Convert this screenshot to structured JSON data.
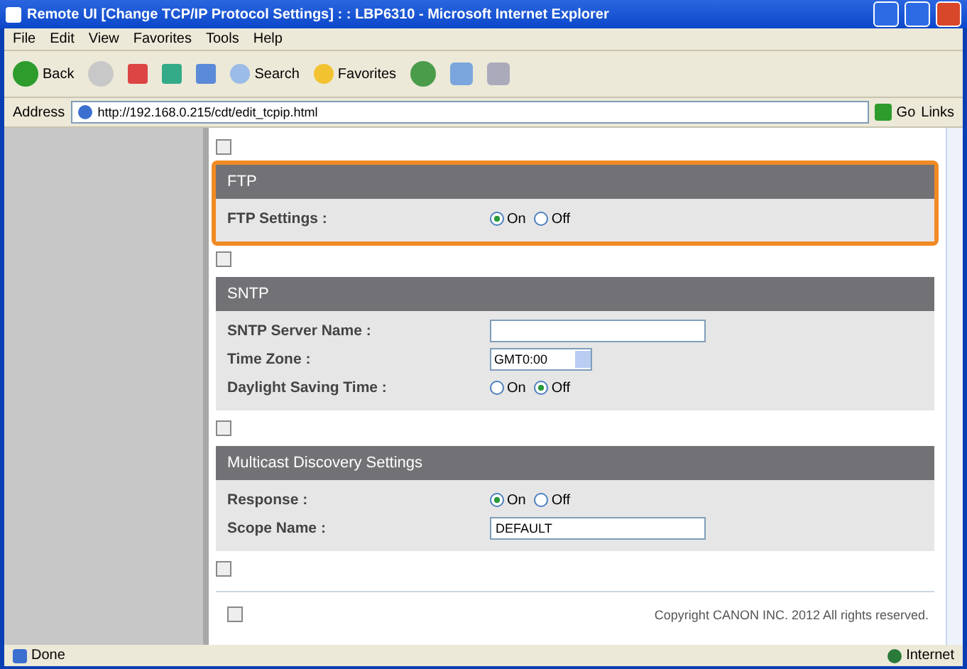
{
  "window": {
    "title": "Remote UI [Change TCP/IP Protocol Settings] : : LBP6310 - Microsoft Internet Explorer"
  },
  "menu": [
    "File",
    "Edit",
    "View",
    "Favorites",
    "Tools",
    "Help"
  ],
  "toolbar": {
    "back": "Back",
    "search": "Search",
    "favorites": "Favorites"
  },
  "address": {
    "label": "Address",
    "url": "http://192.168.0.215/cdt/edit_tcpip.html",
    "go": "Go",
    "links": "Links"
  },
  "sections": [
    {
      "title": "FTP",
      "highlighted": true,
      "rows": [
        {
          "kind": "radio",
          "label": "FTP Settings :",
          "options": [
            {
              "label": "On",
              "selected": true
            },
            {
              "label": "Off",
              "selected": false
            }
          ]
        }
      ]
    },
    {
      "title": "SNTP",
      "highlighted": false,
      "rows": [
        {
          "kind": "text",
          "label": "SNTP Server Name :",
          "value": ""
        },
        {
          "kind": "select",
          "label": "Time Zone :",
          "value": "GMT0:00"
        },
        {
          "kind": "radio",
          "label": "Daylight Saving Time :",
          "options": [
            {
              "label": "On",
              "selected": false
            },
            {
              "label": "Off",
              "selected": true
            }
          ]
        }
      ]
    },
    {
      "title": "Multicast Discovery Settings",
      "highlighted": false,
      "rows": [
        {
          "kind": "radio",
          "label": "Response :",
          "options": [
            {
              "label": "On",
              "selected": true
            },
            {
              "label": "Off",
              "selected": false
            }
          ]
        },
        {
          "kind": "text",
          "label": "Scope Name :",
          "value": "DEFAULT"
        }
      ]
    }
  ],
  "copyright": "Copyright CANON INC. 2012 All rights reserved.",
  "status_bar": {
    "left": "Done",
    "zone": "Internet"
  }
}
